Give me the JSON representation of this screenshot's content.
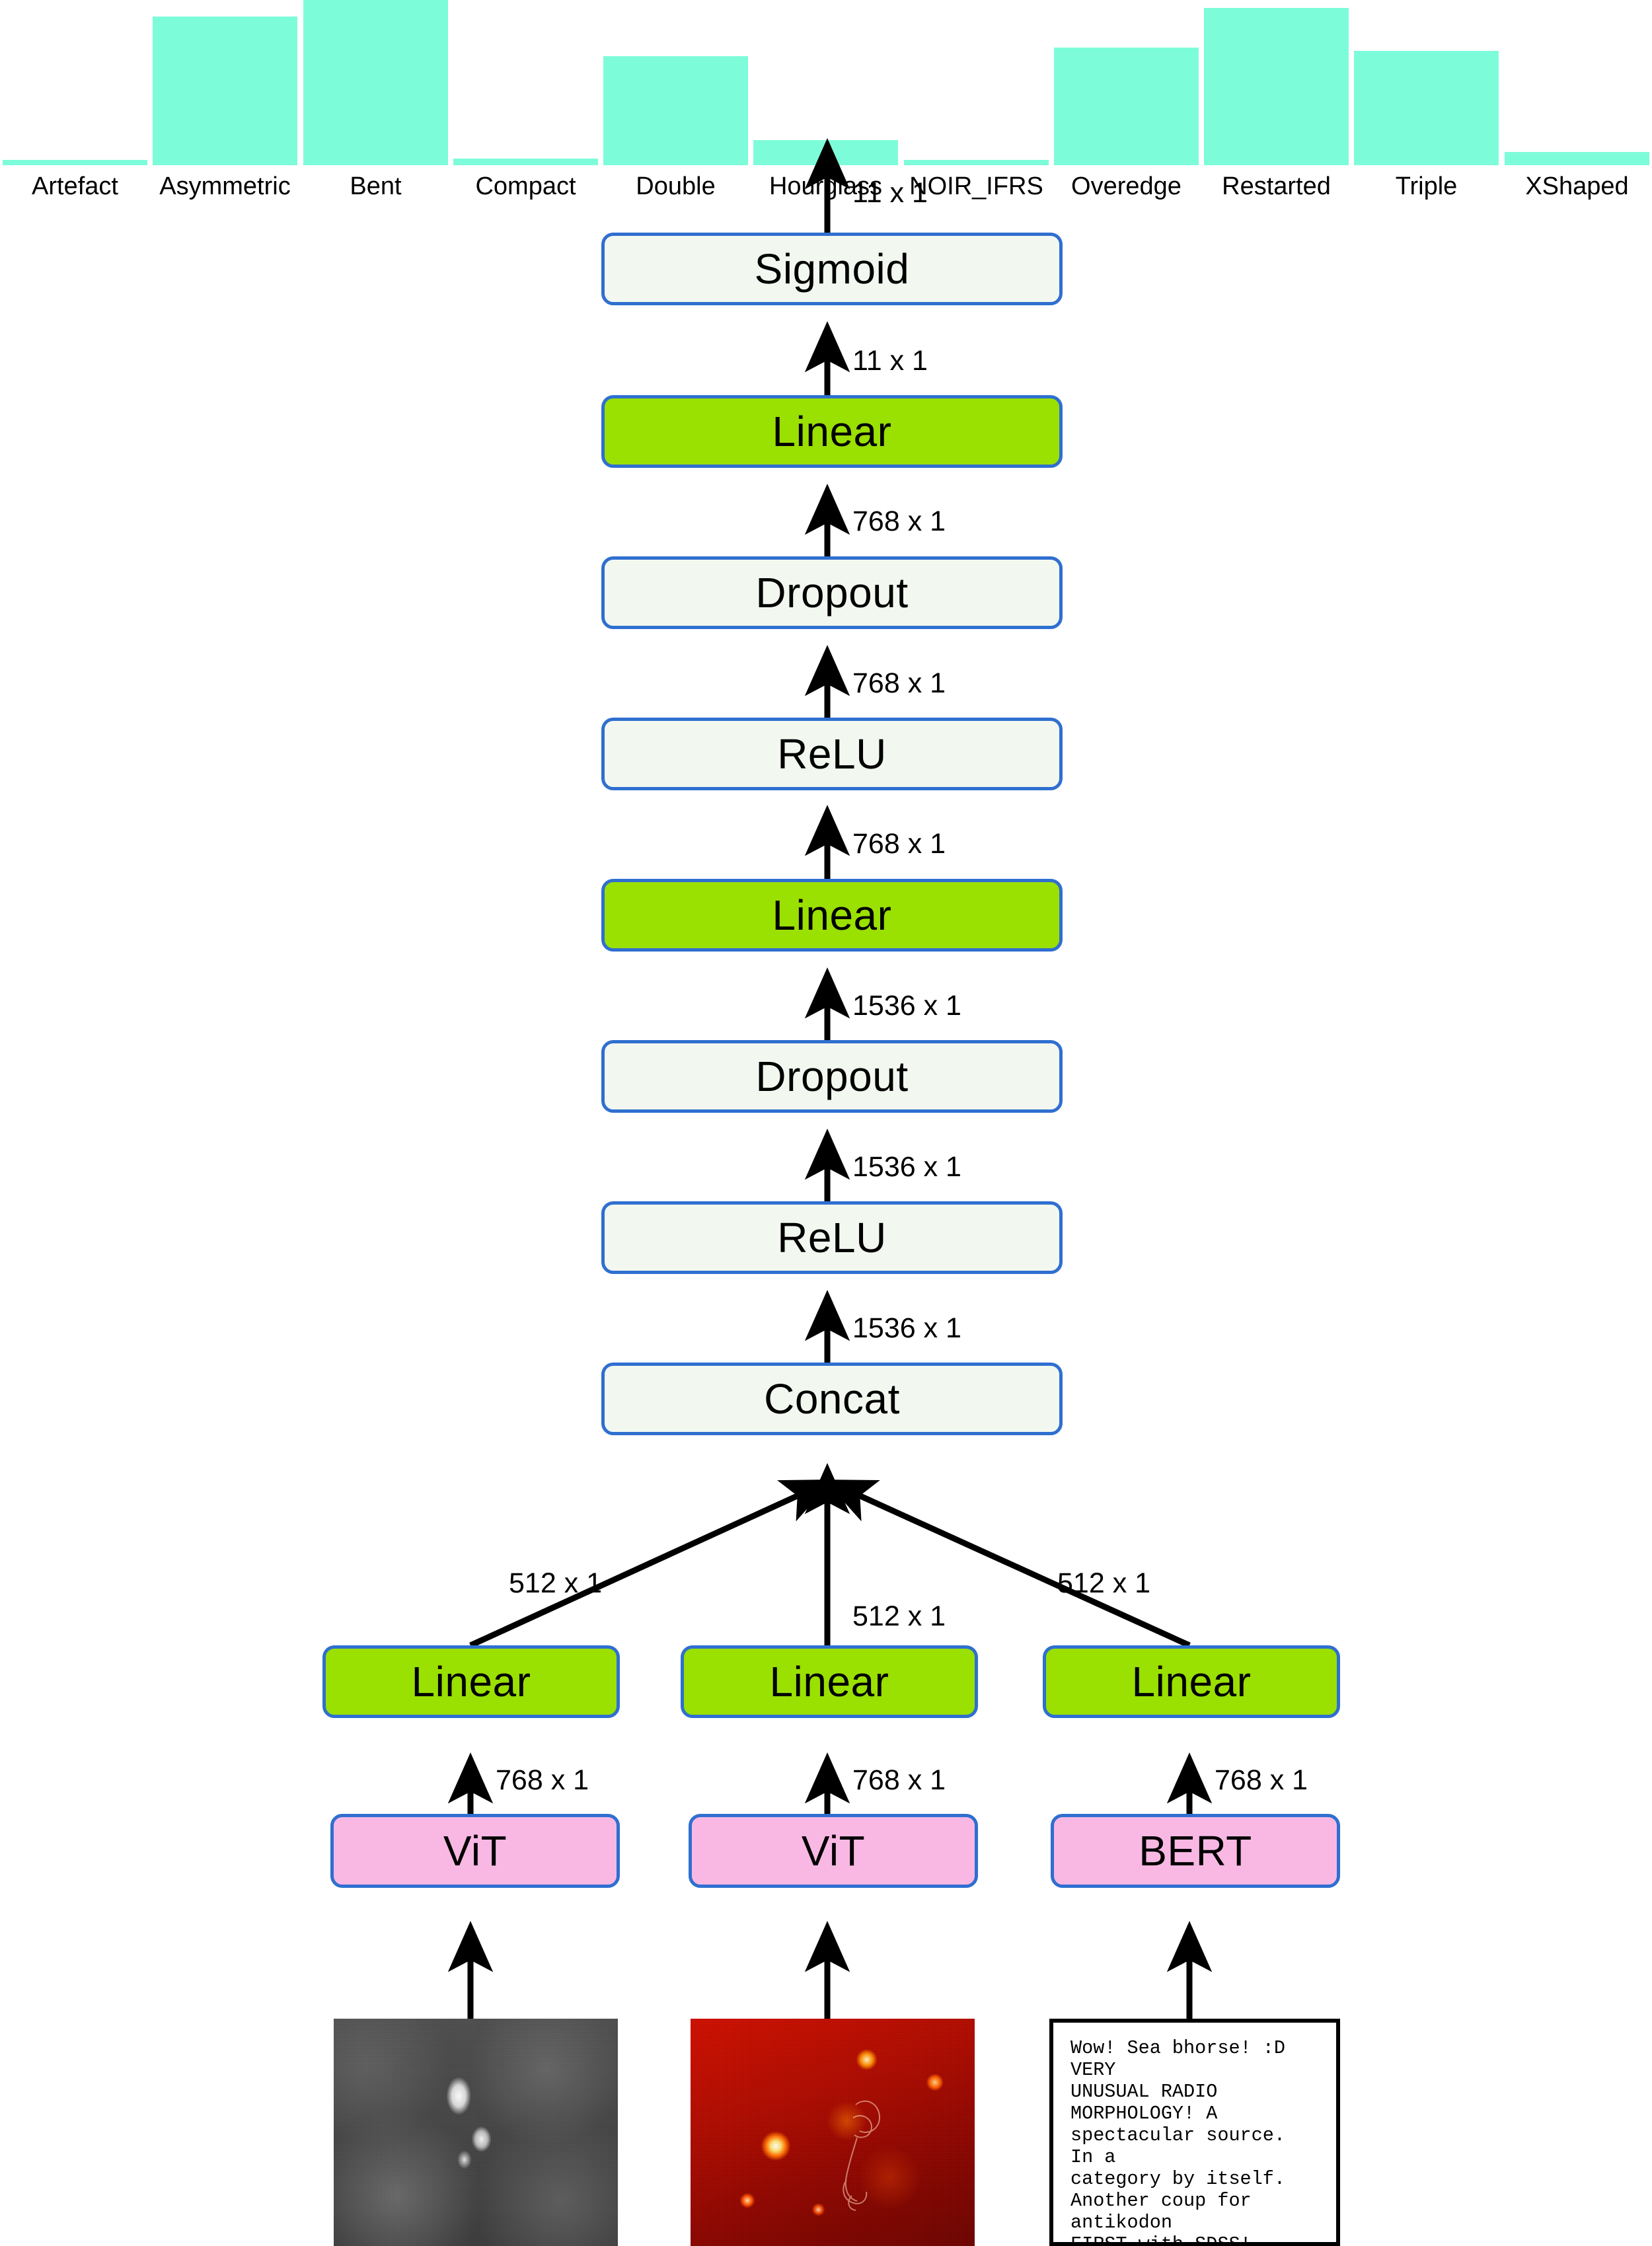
{
  "chart_data": {
    "type": "bar",
    "title": "",
    "xlabel": "",
    "ylabel": "",
    "grid": false,
    "legend": "none",
    "bar_color": "#7dfcda",
    "categories": [
      "Artefact",
      "Asymmetric",
      "Bent",
      "Compact",
      "Double",
      "Hourglass",
      "NOIR_IFRS",
      "Overedge",
      "Restarted",
      "Triple",
      "XShaped"
    ],
    "values": [
      3,
      90,
      100,
      4,
      66,
      15,
      3,
      71,
      95,
      69,
      8
    ],
    "ylim": [
      0,
      100
    ],
    "note": "values are relative bar heights read off the plot (Bent is the tallest, normalised to 100)"
  },
  "diagram": {
    "nodes": {
      "sigmoid": "Sigmoid",
      "linear_top": "Linear",
      "dropout_top": "Dropout",
      "relu_top": "ReLU",
      "linear_mid": "Linear",
      "dropout_mid": "Dropout",
      "relu_mid": "ReLU",
      "concat": "Concat",
      "linear_left": "Linear",
      "linear_center": "Linear",
      "linear_right": "Linear",
      "vit_left": "ViT",
      "vit_center": "ViT",
      "bert_right": "BERT"
    },
    "edge_labels": {
      "out": "11 x 1",
      "sigmoid_in": "11 x 1",
      "linear_top_in": "768 x 1",
      "dropout_top_in": "768 x 1",
      "relu_top_in": "768 x 1",
      "linear_mid_in": "1536 x 1",
      "dropout_mid_in": "1536 x 1",
      "relu_mid_in": "1536 x 1",
      "concat_left": "512 x 1",
      "concat_center": "512 x 1",
      "concat_right": "512 x 1",
      "vit_left_out": "768 x 1",
      "vit_center_out": "768 x 1",
      "bert_right_out": "768 x 1"
    },
    "colors": {
      "border": "#2f6fd0",
      "pale_fill": "#f2f8ef",
      "green_fill": "#9ae000",
      "pink_fill": "#f9b8e4",
      "arrow": "#000000"
    },
    "inputs": {
      "left_image_alt": "greyscale optical cutout",
      "center_image_alt": "radio heatmap cutout",
      "comment_text": "Wow! Sea bhorse! :D VERY\nUNUSUAL RADIO MORPHOLOGY! A\nspectacular source.  In a\ncategory by itself.\nAnother coup for antikodon\nFIRST with SDSS!\nIncredible! It's amazing to\nsee that sharp edge on the\nradio emission in the lower\nright; front of a shock?\nCould these be two separate\ndoublelobes/hourglasses?\nHow best to determine\nwhether or not they are\nrelated? @WizardHowl - my\nfirst reaction was the same\nas yours. But I really\ndidn't see plausible ..."
    }
  }
}
